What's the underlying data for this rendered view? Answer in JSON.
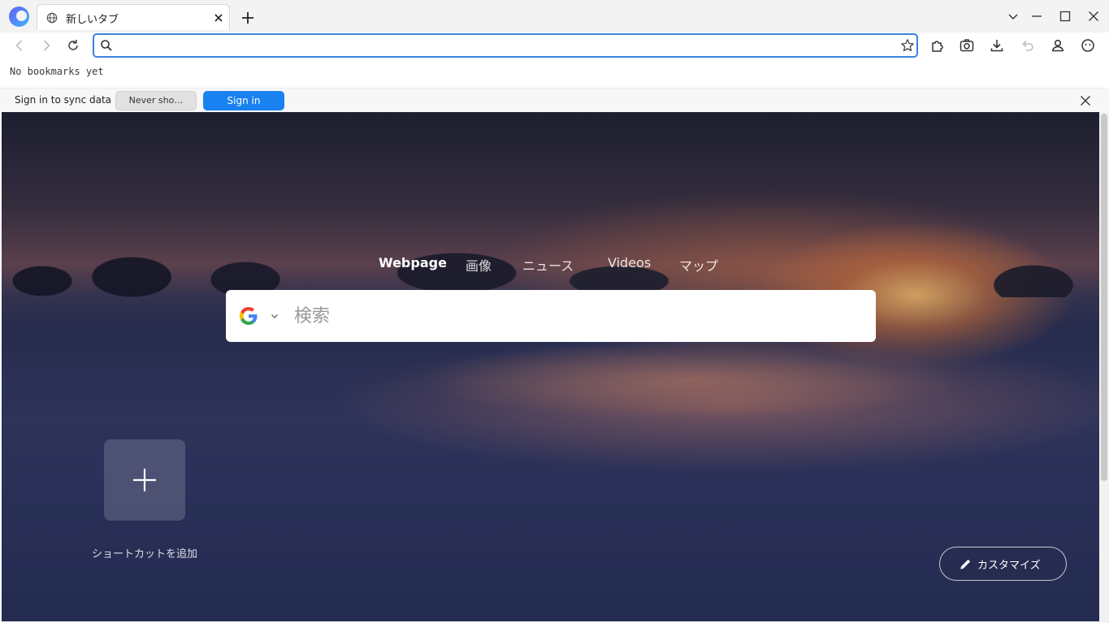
{
  "tab": {
    "title": "新しいタブ"
  },
  "address_bar": {
    "value": "",
    "placeholder": ""
  },
  "bookmarks_bar": {
    "empty_text": "No bookmarks yet"
  },
  "sync_bar": {
    "message": "Sign in to sync data",
    "never_label": "Never sho…",
    "signin_label": "Sign in"
  },
  "new_tab_page": {
    "engine_tabs": [
      "Webpage",
      "画像",
      "ニュース",
      "Videos",
      "マップ"
    ],
    "active_engine_tab": "Webpage",
    "search_placeholder": "検索",
    "search_engine_icon": "google-g-icon",
    "add_shortcut_label": "ショートカットを追加",
    "customize_label": "カスタマイズ"
  },
  "colors": {
    "accent": "#1a82f0",
    "urlbar_focus": "#3b82e0"
  }
}
